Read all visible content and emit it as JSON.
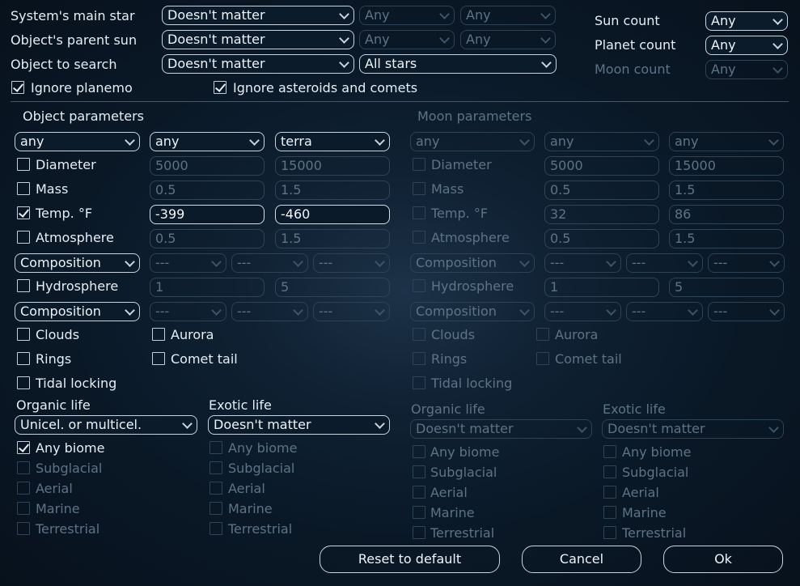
{
  "top": {
    "main_star": {
      "label": "System's main star",
      "value": "Doesn't matter",
      "a": "Any",
      "b": "Any"
    },
    "parent_sun": {
      "label": "Object's parent sun",
      "value": "Doesn't matter",
      "a": "Any",
      "b": "Any"
    },
    "object_search": {
      "label": "Object to search",
      "value": "Doesn't matter",
      "b": "All stars"
    },
    "sun_count": {
      "label": "Sun count",
      "value": "Any"
    },
    "planet_count": {
      "label": "Planet count",
      "value": "Any"
    },
    "moon_count": {
      "label": "Moon count",
      "value": "Any"
    },
    "ignore_planemo": "Ignore planemo",
    "ignore_asteroids": "Ignore asteroids and comets"
  },
  "object": {
    "title": "Object parameters",
    "sel1": "any",
    "sel2": "any",
    "sel3": "terra",
    "diameter": {
      "label": "Diameter",
      "min": "5000",
      "max": "15000"
    },
    "mass": {
      "label": "Mass",
      "min": "0.5",
      "max": "1.5"
    },
    "temp": {
      "label": "Temp. °F",
      "min": "-399",
      "max": "-460"
    },
    "atmosphere": {
      "label": "Atmosphere",
      "min": "0.5",
      "max": "1.5"
    },
    "composition": "Composition",
    "dash": "---",
    "hydrosphere": {
      "label": "Hydrosphere",
      "min": "1",
      "max": "5"
    },
    "clouds": "Clouds",
    "aurora": "Aurora",
    "rings": "Rings",
    "comet_tail": "Comet tail",
    "tidal": "Tidal locking",
    "organic_life": "Organic life",
    "organic_value": "Unicel. or multicel.",
    "exotic_life": "Exotic life",
    "exotic_value": "Doesn't matter",
    "any_biome": "Any biome",
    "subglacial": "Subglacial",
    "aerial": "Aerial",
    "marine": "Marine",
    "terrestrial": "Terrestrial"
  },
  "moon": {
    "title": "Moon parameters",
    "sel1": "any",
    "sel2": "any",
    "sel3": "any",
    "diameter": {
      "label": "Diameter",
      "min": "5000",
      "max": "15000"
    },
    "mass": {
      "label": "Mass",
      "min": "0.5",
      "max": "1.5"
    },
    "temp": {
      "label": "Temp. °F",
      "min": "32",
      "max": "86"
    },
    "atmosphere": {
      "label": "Atmosphere",
      "min": "0.5",
      "max": "1.5"
    },
    "composition": "Composition",
    "dash": "---",
    "hydrosphere": {
      "label": "Hydrosphere",
      "min": "1",
      "max": "5"
    },
    "clouds": "Clouds",
    "aurora": "Aurora",
    "rings": "Rings",
    "comet_tail": "Comet tail",
    "tidal": "Tidal locking",
    "organic_life": "Organic life",
    "organic_value": "Doesn't matter",
    "exotic_life": "Exotic life",
    "exotic_value": "Doesn't matter",
    "any_biome": "Any biome",
    "subglacial": "Subglacial",
    "aerial": "Aerial",
    "marine": "Marine",
    "terrestrial": "Terrestrial"
  },
  "buttons": {
    "reset": "Reset to default",
    "cancel": "Cancel",
    "ok": "Ok"
  }
}
